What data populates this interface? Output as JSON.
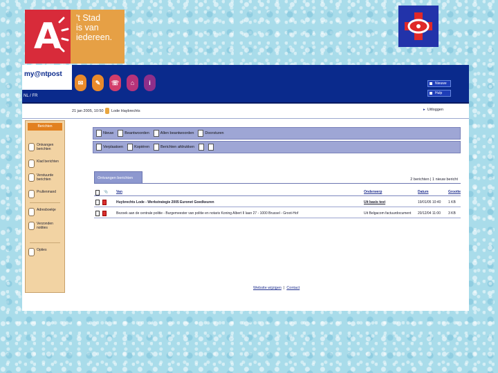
{
  "logo": {
    "text_lines": [
      "'t Stad",
      "is van",
      "iedereen."
    ],
    "letter": "A"
  },
  "app": {
    "brand": "my@ntpost",
    "brand_sub": "NL / FR",
    "nav_icons": [
      {
        "name": "inbox-nav-icon",
        "color": "#e98a2a",
        "glyph": "✉"
      },
      {
        "name": "compose-nav-icon",
        "color": "#e98a2a",
        "glyph": "✎"
      },
      {
        "name": "addressbook-nav-icon",
        "color": "#d23d6a",
        "glyph": "☏"
      },
      {
        "name": "folders-nav-icon",
        "color": "#b8337a",
        "glyph": "⌂"
      },
      {
        "name": "info-nav-icon",
        "color": "#8e2f8a",
        "glyph": "i"
      }
    ],
    "top_buttons": [
      "Nieuwe",
      "Hulp"
    ],
    "date": "21 jan 2005, 10:50",
    "user": "Lode Haybrechts",
    "logout": "Uitloggen"
  },
  "sidebar": {
    "header": "Berichten",
    "items": [
      "Ontvangen berichten",
      "Klad berichten",
      "Verstuurde berichten",
      "Prullenmand",
      "Adresboekje",
      "Verzonden notities",
      "Opties"
    ]
  },
  "toolbar1": [
    "Nieuw",
    "Beantwoorden",
    "Allen beantwoorden",
    "Doorsturen"
  ],
  "toolbar2": [
    "Verplaatsen",
    "Kopiëren",
    "Berichten afdrukken"
  ],
  "folder": {
    "tab": "Ontvangen berichten",
    "page_info": "2 berichten | 1 nieuw bericht"
  },
  "table": {
    "headers": {
      "subject": "Van",
      "sender": "Onderwerp",
      "date": "Datum",
      "size": "Grootte"
    },
    "rows": [
      {
        "subject": "Huybrechts Lode - Werkstrategie 2005 Euronet Goedkeuren",
        "sender": "Uit basis test",
        "date": "19/01/05 10:40",
        "size": "1 KB"
      },
      {
        "subject": "Bezoek aan de centrale politie - Burgemeester van politie en notaris Koning Albert II laan 27 - 1000 Brussel - Groot-Hof",
        "sender": "Uit Belgacom factuurdocument",
        "date": "20/12/04 11:00",
        "size": "3 KB"
      }
    ]
  },
  "footer": {
    "link1": "Website wijzigen",
    "sep": "|",
    "link2": "Contact"
  }
}
